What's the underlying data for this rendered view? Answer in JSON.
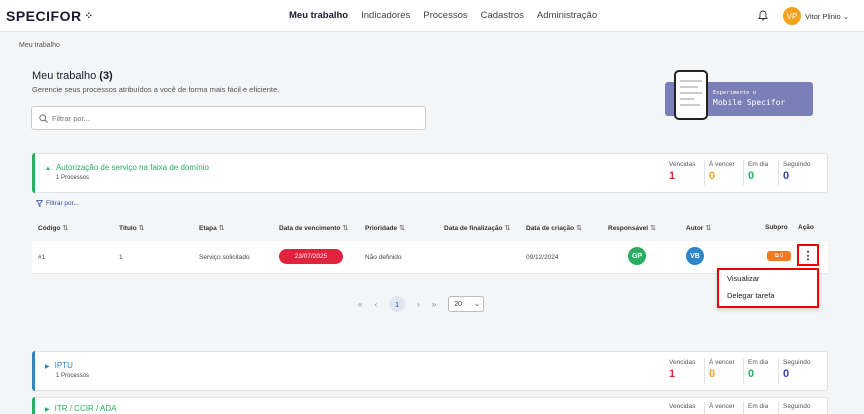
{
  "header": {
    "logo": "SPECIFOR",
    "nav": [
      "Meu trabalho",
      "Indicadores",
      "Processos",
      "Cadastros",
      "Administração"
    ],
    "user_initials": "VP",
    "user_name": "Vitor Plinio"
  },
  "breadcrumb": "Meu trabalho",
  "page": {
    "title": "Meu trabalho",
    "count": "(3)",
    "subtitle": "Gerencie seus processos atribuídos a você de forma mais fácil e eficiente.",
    "filter_placeholder": "Filtrar por..."
  },
  "promo": {
    "line1": "Experimente o",
    "line2": "Mobile Specifor"
  },
  "stat_labels": [
    "Vencidas",
    "À vencer",
    "Em dia",
    "Seguindo"
  ],
  "groups": [
    {
      "title": "Autorização de serviço na faixa de domínio",
      "sub": "1 Processos",
      "stats": [
        "1",
        "0",
        "0",
        "0"
      ]
    },
    {
      "title": "IPTU",
      "sub": "1 Processos",
      "stats": [
        "1",
        "0",
        "0",
        "0"
      ]
    },
    {
      "title": "ITR / CCIR / ADA"
    }
  ],
  "table": {
    "filter_label": "Filtrar por...",
    "columns": [
      "Código",
      "Título",
      "Etapa",
      "Data de vencimento",
      "Prioridade",
      "Data de finalização",
      "Data de criação",
      "Responsável",
      "Autor",
      "Subpro",
      "Ação"
    ],
    "row": {
      "code": "#1",
      "title": "1",
      "stage": "Serviço solicitado",
      "due": "23/07/2025",
      "priority": "Não definido",
      "created": "09/12/2024",
      "responsible": "GP",
      "author": "VB",
      "subpro": "⧉ 0"
    }
  },
  "menu": [
    "Visualizar",
    "Delegar tarefa"
  ],
  "pagination": {
    "current": "1",
    "per_page": "20"
  },
  "colors": {
    "accent": "#2d4fa0",
    "green": "#27ae60",
    "red": "#e0243d",
    "orange": "#f4a11d",
    "blue": "#2d86c7",
    "purple": "#3b3fa8"
  },
  "icons": [
    "bell-icon",
    "search-icon",
    "filter-icon",
    "chevron-down-icon",
    "kebab-icon"
  ]
}
